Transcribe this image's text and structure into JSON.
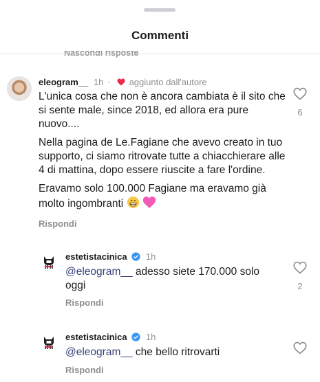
{
  "header": {
    "title": "Commenti",
    "hidden_replies": "Nascondi risposte"
  },
  "comments": [
    {
      "username": "eleogram__",
      "time": "1h",
      "badge": "aggiunto dall'autore",
      "paragraphs": [
        "L'unica cosa che non è ancora cambiata è il sito che si sente male, since 2018, ed allora era pure nuovo....",
        "Nella pagina de Le.Fagiane che avevo creato in tuo supporto, ci siamo ritrovate tutte a chiacchierare alle 4 di mattina, dopo essere riuscite a fare l'ordine.",
        "Eravamo solo 100.000 Fagiane ma eravamo già molto ingombranti"
      ],
      "emojis": [
        "grinning-face-emoji",
        "pink-heart-emoji"
      ],
      "reply_label": "Rispondi",
      "like_count": "6"
    },
    {
      "username": "estetistacinica",
      "time": "1h",
      "mention": "@eleogram__",
      "text": " adesso siete 170.000 solo oggi",
      "reply_label": "Rispondi",
      "like_count": "2"
    },
    {
      "username": "estetistacinica",
      "time": "1h",
      "mention": "@eleogram__",
      "text": " che bello ritrovarti",
      "reply_label": "Rispondi"
    }
  ],
  "colors": {
    "text": "#1c1c1e",
    "muted": "#8e8e93",
    "mention": "#36417a",
    "heart": "#ed2a4a",
    "verified": "#3897f0"
  }
}
